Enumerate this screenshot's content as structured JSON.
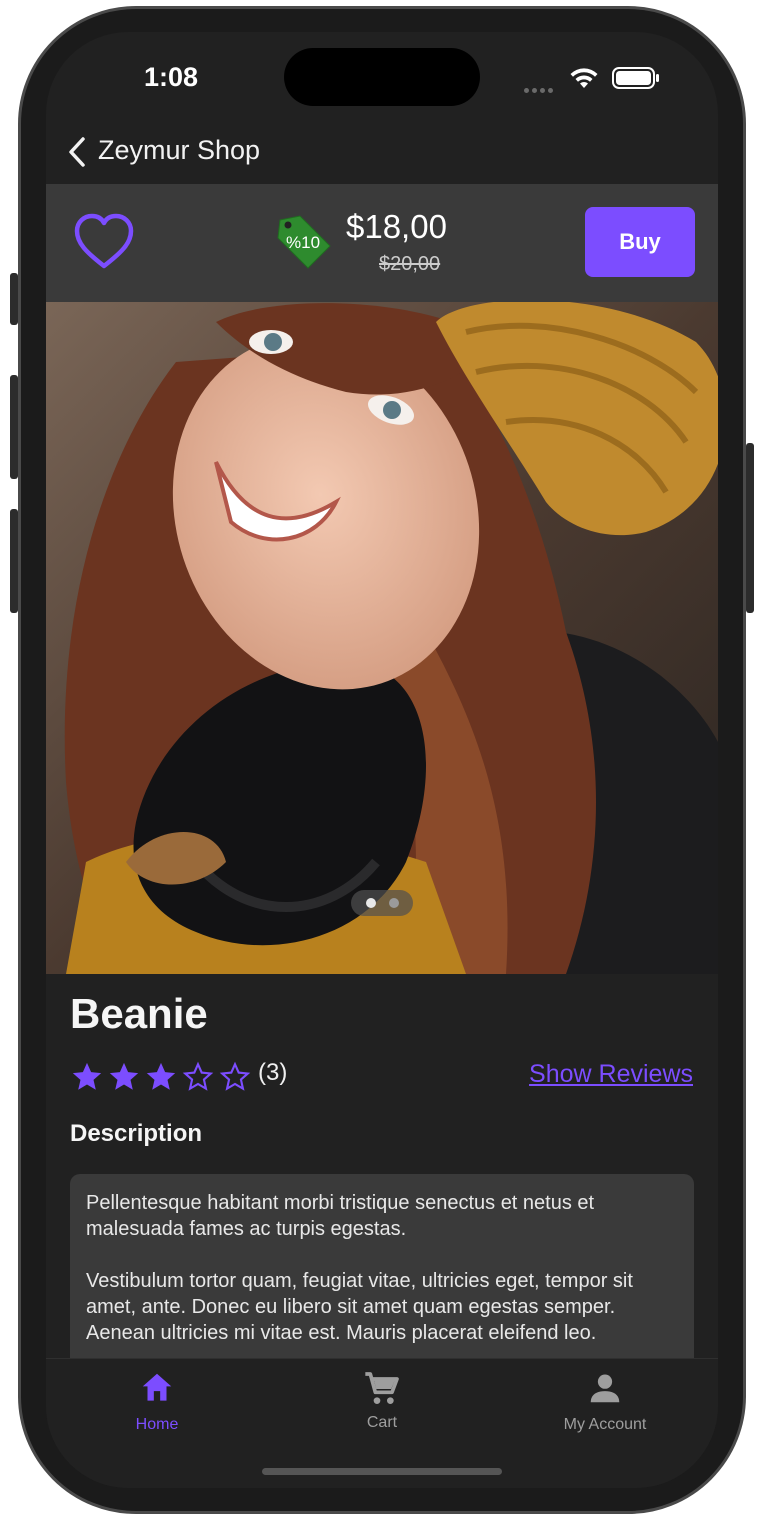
{
  "status_bar": {
    "time": "1:08"
  },
  "nav": {
    "back_title": "Zeymur Shop"
  },
  "price_bar": {
    "discount_tag": "%10",
    "price": "$18,00",
    "old_price": "$20,00",
    "buy_label": "Buy"
  },
  "carousel": {
    "page_count": 2,
    "current_page": 1
  },
  "product": {
    "title": "Beanie",
    "rating": 3,
    "rating_max": 5,
    "rating_count": "(3)",
    "show_reviews": "Show Reviews",
    "description_heading": "Description",
    "description_p1": "Pellentesque habitant morbi tristique senectus et netus et malesuada fames ac turpis egestas.",
    "description_p2": "Vestibulum tortor quam, feugiat vitae, ultricies eget, tempor sit amet, ante. Donec eu libero sit amet quam egestas semper. Aenean ultricies mi vitae est. Mauris placerat eleifend leo."
  },
  "tabs": [
    {
      "label": "Home",
      "icon": "home-icon",
      "active": true
    },
    {
      "label": "Cart",
      "icon": "cart-icon",
      "active": false
    },
    {
      "label": "My Account",
      "icon": "person-icon",
      "active": false
    }
  ],
  "colors": {
    "accent": "#7c4dff",
    "background": "#212121",
    "bar": "#3a3a3a",
    "tag_green": "#2e8b2e"
  }
}
